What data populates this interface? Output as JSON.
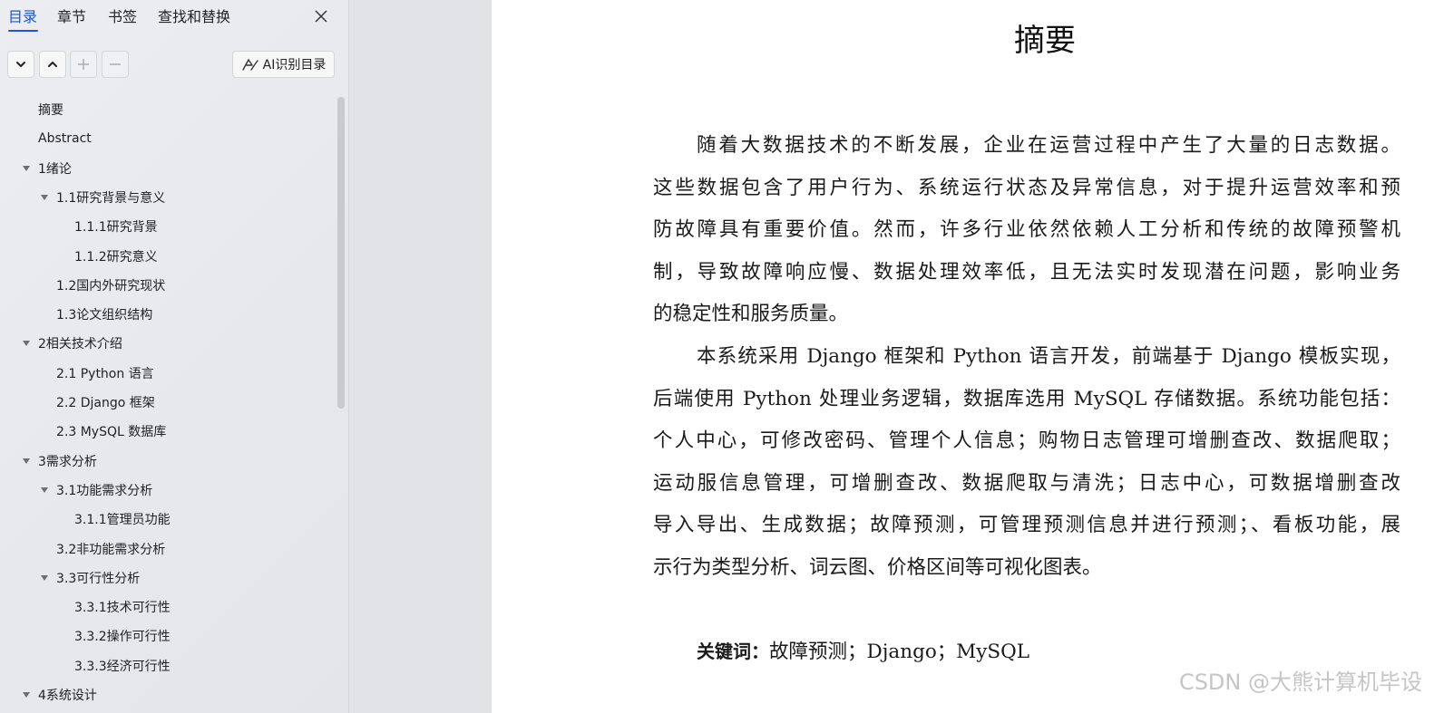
{
  "sidebar": {
    "tabs": [
      {
        "label": "目录",
        "active": true
      },
      {
        "label": "章节",
        "active": false
      },
      {
        "label": "书签",
        "active": false
      },
      {
        "label": "查找和替换",
        "active": false
      }
    ],
    "ai_button_label": "AI识别目录",
    "toc": [
      {
        "label": "摘要",
        "level": 1,
        "expandable": false
      },
      {
        "label": "Abstract",
        "level": 1,
        "expandable": false
      },
      {
        "label": "1绪论",
        "level": 1,
        "expandable": true
      },
      {
        "label": "1.1研究背景与意义",
        "level": 2,
        "expandable": true
      },
      {
        "label": "1.1.1研究背景",
        "level": 3,
        "expandable": false
      },
      {
        "label": "1.1.2研究意义",
        "level": 3,
        "expandable": false
      },
      {
        "label": "1.2国内外研究现状",
        "level": 2,
        "expandable": false
      },
      {
        "label": "1.3论文组织结构",
        "level": 2,
        "expandable": false
      },
      {
        "label": "2相关技术介绍",
        "level": 1,
        "expandable": true
      },
      {
        "label": "2.1 Python 语言",
        "level": 2,
        "expandable": false
      },
      {
        "label": "2.2 Django 框架",
        "level": 2,
        "expandable": false
      },
      {
        "label": "2.3 MySQL 数据库",
        "level": 2,
        "expandable": false
      },
      {
        "label": "3需求分析",
        "level": 1,
        "expandable": true
      },
      {
        "label": "3.1功能需求分析",
        "level": 2,
        "expandable": true
      },
      {
        "label": "3.1.1管理员功能",
        "level": 3,
        "expandable": false
      },
      {
        "label": "3.2非功能需求分析",
        "level": 2,
        "expandable": false
      },
      {
        "label": "3.3可行性分析",
        "level": 2,
        "expandable": true
      },
      {
        "label": "3.3.1技术可行性",
        "level": 3,
        "expandable": false
      },
      {
        "label": "3.3.2操作可行性",
        "level": 3,
        "expandable": false
      },
      {
        "label": "3.3.3经济可行性",
        "level": 3,
        "expandable": false
      },
      {
        "label": "4系统设计",
        "level": 1,
        "expandable": true
      }
    ]
  },
  "document": {
    "title": "摘要",
    "paragraph1_lines": [
      "随着大数据技术的不断发展，企业在运营过程中产生了大量的日志数据。",
      "这些数据包含了用户行为、系统运行状态及异常信息，对于提升运营效率和预",
      "防故障具有重要价值。然而，许多行业依然依赖人工分析和传统的故障预警机",
      "制，导致故障响应慢、数据处理效率低，且无法实时发现潜在问题，影响业务",
      "的稳定性和服务质量。"
    ],
    "paragraph2_lines": [
      "本系统采用 Django 框架和 Python 语言开发，前端基于 Django 模板实现，",
      "后端使用 Python 处理业务逻辑，数据库选用 MySQL 存储数据。系统功能包括：",
      "个人中心，可修改密码、管理个人信息；购物日志管理可增删查改、数据爬取；",
      "运动服信息管理，可增删查改、数据爬取与清洗；日志中心，可数据增删查改",
      "导入导出、生成数据；故障预测，可管理预测信息并进行预测；、看板功能，展",
      "示行为类型分析、词云图、价格区间等可视化图表。"
    ],
    "keywords_label": "关键词：",
    "keywords": "故障预测；Django；MySQL"
  },
  "watermark": "CSDN @大熊计算机毕设",
  "colors": {
    "accent": "#1a56d6",
    "sidebar_bg": "#e9ebee",
    "page_bg": "#ffffff"
  }
}
